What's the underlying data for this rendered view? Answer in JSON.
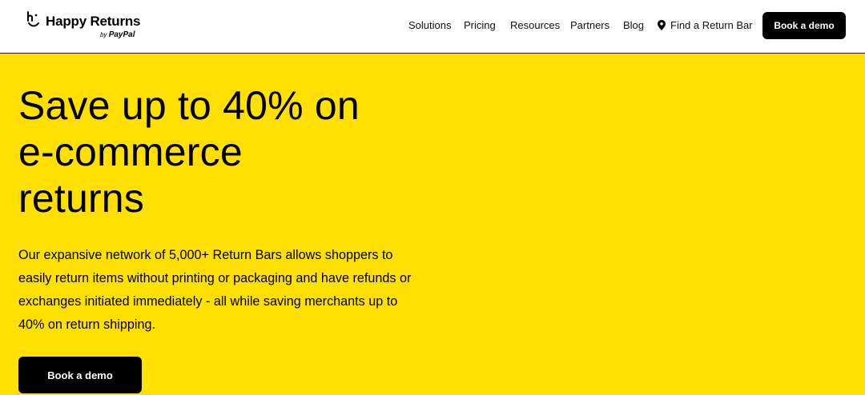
{
  "brand": {
    "name": "Happy Returns",
    "by_prefix": "by",
    "by_name": "PayPal",
    "logo_icon": "smile-logo-icon"
  },
  "nav": {
    "items": [
      {
        "label": "Solutions"
      },
      {
        "label": "Pricing"
      },
      {
        "label": "Resources"
      },
      {
        "label": "Partners"
      },
      {
        "label": "Blog"
      },
      {
        "label": "Find a Return Bar",
        "icon": "map-pin-icon"
      }
    ],
    "cta_label": "Book a demo"
  },
  "hero": {
    "headline_lines": [
      "Save up to 40% on",
      "e-commerce",
      "returns"
    ],
    "description": "Our expansive network of 5,000+ Return Bars allows shoppers to easily return items without printing or packaging and have refunds or exchanges initiated immediately - all while saving merchants up to 40% on return shipping.",
    "cta_label": "Book a demo"
  },
  "colors": {
    "hero_background": "#ffe000",
    "button_background": "#000000",
    "button_text": "#ffffff"
  }
}
